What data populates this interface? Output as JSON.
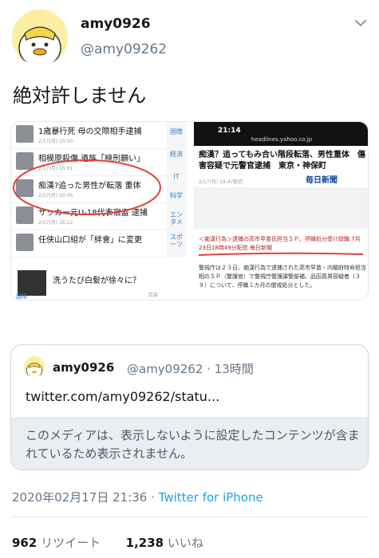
{
  "author": {
    "display_name": "amy0926",
    "handle": "@amy09262"
  },
  "tweet": {
    "text": "絶対許しません"
  },
  "media": {
    "left_screenshot": {
      "news": [
        {
          "title": "1歳暴行死 母の交際相手逮捕",
          "meta": "2/17(月) 15:50"
        },
        {
          "title": "相模原殺傷 遺族「極刑願い」",
          "meta": "2/17(月) 15:01"
        },
        {
          "title": "痴漢?追った男性が転落 重体",
          "meta": "2/17(月) 20:45"
        },
        {
          "title": "サッカー元U-18代表宿盗 逮捕",
          "meta": "2/17(月) 16:22"
        },
        {
          "title": "任侠山口組が「絆會」に変更",
          "meta": ""
        }
      ],
      "side_tabs": [
        "国際",
        "経済",
        "IT",
        "科学",
        "エンタメ",
        "スポーツ"
      ],
      "ad": {
        "title": "洗うたび白髪が徐々に？",
        "sub": "",
        "label": "広告"
      },
      "bottom_tab": "国際"
    },
    "right_screenshot": {
      "time": "21:14",
      "url": "headlines.yahoo.co.jp",
      "title": "痴漢？追ってもみ合い階段転落、男性重体　傷害容疑で元警官逮捕　東京・神保町",
      "date": "2/17(月) 19:47配信",
      "publisher": "毎日新聞",
      "subhead": "＜痴漢行為＞逮捕の高市早苗氏担当ＳＰ、停職処分受け辞職 7月23日18時49分配信 毎日新聞",
      "body": "警視庁は２３日、痴漢行為で逮捕された高市早苗・内閣府特命担当相のＳＰ（警護官）で警視庁警護課警部補、品田真男容疑者（３９）について、停職１カ月の懲戒処分とした。"
    }
  },
  "quote": {
    "display_name": "amy0926",
    "handle_time": "@amy09262 · 13時間",
    "link": "twitter.com/amy09262/statu...",
    "notice": "このメディアは、表示しないように設定したコンテンツが含まれているため表示されません。"
  },
  "meta": {
    "timestamp": "2020年02月17日 21:36",
    "separator": " · ",
    "source": "Twitter for iPhone"
  },
  "stats": {
    "retweets": "962",
    "retweets_label": "リツイート",
    "likes": "1,238",
    "likes_label": "いいね"
  },
  "colors": {
    "link": "#1da1f2",
    "secondary": "#657786",
    "annotation_red": "#e0413a"
  }
}
